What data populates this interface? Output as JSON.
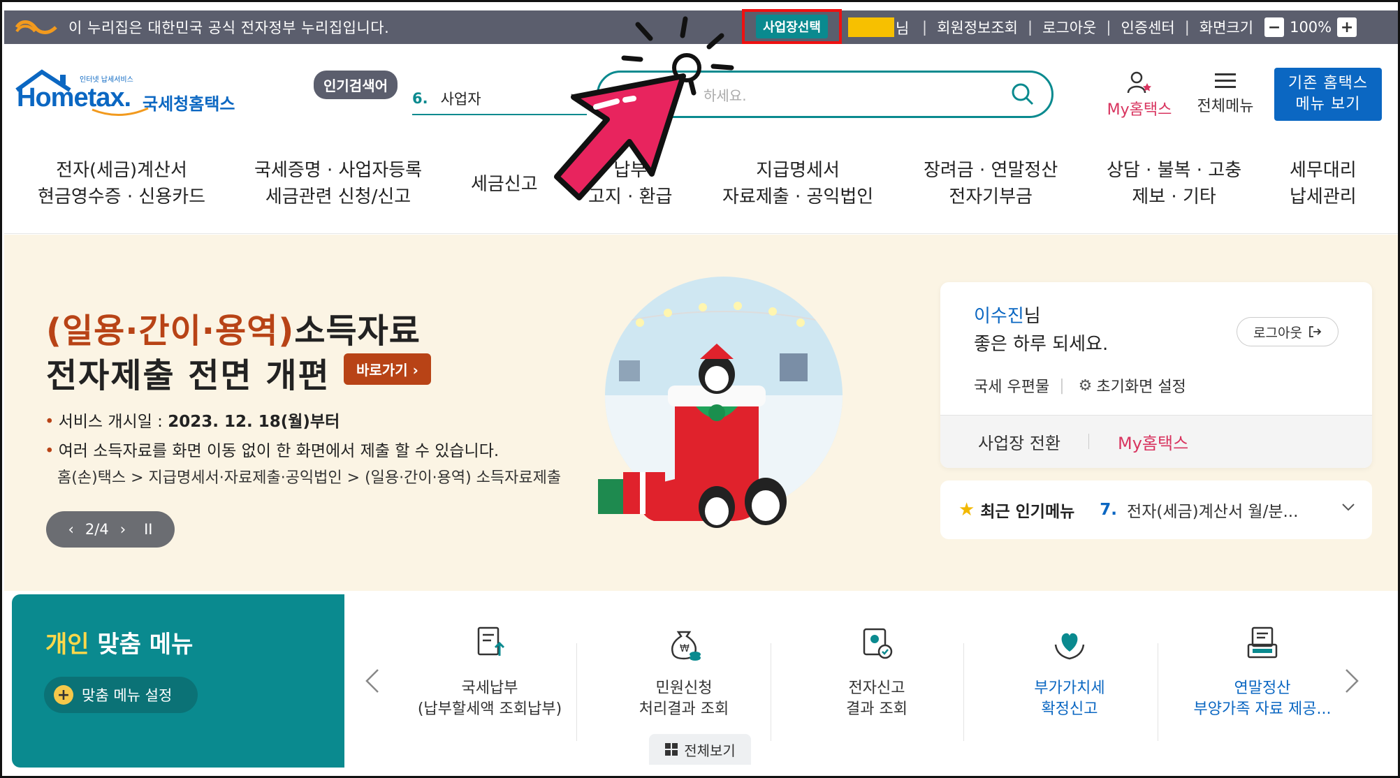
{
  "govbar": {
    "notice": "이 누리집은 대한민국 공식 전자정부 누리집입니다.",
    "biz_select": "사업장선택",
    "user_suffix": "님",
    "links": [
      "회원정보조회",
      "로그아웃",
      "인증센터",
      "화면크기"
    ],
    "zoom_minus": "−",
    "zoom_value": "100%",
    "zoom_plus": "+"
  },
  "header": {
    "logo_small": "인터넷 납세서비스",
    "logo_main": "Hometax.",
    "logo_kr": "국세청홈택스",
    "popular_badge": "인기검색어",
    "popular_num": "6.",
    "popular_term": "사업자",
    "search_placeholder": "하세요.",
    "my_hometax": "My홈택스",
    "all_menu": "전체메뉴",
    "old_menu_line1": "기존 홈택스",
    "old_menu_line2": "메뉴 보기"
  },
  "nav": [
    {
      "l1": "전자(세금)계산서",
      "l2": "현금영수증 · 신용카드"
    },
    {
      "l1": "국세증명 · 사업자등록",
      "l2": "세금관련 신청/신고"
    },
    {
      "l1": "세금신고",
      "l2": ""
    },
    {
      "l1": "납부",
      "l2": "고지 · 환급"
    },
    {
      "l1": "지급명세서",
      "l2": "자료제출 · 공익법인"
    },
    {
      "l1": "장려금 · 연말정산",
      "l2": "전자기부금"
    },
    {
      "l1": "상담 · 불복 · 고충",
      "l2": "제보 · 기타"
    },
    {
      "l1": "세무대리",
      "l2": "납세관리"
    }
  ],
  "banner": {
    "title_hl": "(일용·간이·용역)",
    "title_rest": "소득자료",
    "title2": "전자제출 전면 개편",
    "goto": "바로가기 ›",
    "bullet1_label": "서비스 개시일 : ",
    "bullet1_value": "2023. 12. 18(월)부터",
    "bullet2": "여러 소득자료를 화면 이동 없이 한 화면에서 제출 할 수 있습니다.",
    "path": "홈(손)택스 > 지급명세서·자료제출·공익법인 > (일용·간이·용역) 소득자료제출",
    "slider_prev": "‹",
    "slider_pos": "2/4",
    "slider_next": "›",
    "slider_pause": "II"
  },
  "login_card": {
    "name": "이수진",
    "name_suffix": "님",
    "greeting": "좋은 하루 되세요.",
    "logout": "로그아웃",
    "mail": "국세 우편물",
    "home_setting": "초기화면 설정",
    "biz_switch": "사업장 전환",
    "my_hometax": "My홈택스"
  },
  "recent": {
    "label": "최근 인기메뉴",
    "num": "7.",
    "text": "전자(세금)계산서 월/분..."
  },
  "custom_menu": {
    "title_hl": "개인",
    "title_rest": " 맞춤 메뉴",
    "setting": "맞춤 메뉴 설정",
    "items": [
      {
        "l1": "국세납부",
        "l2": "(납부할세액 조회납부)"
      },
      {
        "l1": "민원신청",
        "l2": "처리결과 조회"
      },
      {
        "l1": "전자신고",
        "l2": "결과 조회"
      },
      {
        "l1": "부가가치세",
        "l2": "확정신고"
      },
      {
        "l1": "연말정산",
        "l2": "부양가족 자료 제공..."
      }
    ],
    "all_view": "전체보기"
  },
  "colors": {
    "gov_bar": "#5b5e6d",
    "teal": "#0a8a8f",
    "blue": "#0b67c2",
    "pink": "#d8345f",
    "banner_bg": "#fbf4e4",
    "highlight_box": "#e11111",
    "pointer": "#e8245e"
  }
}
